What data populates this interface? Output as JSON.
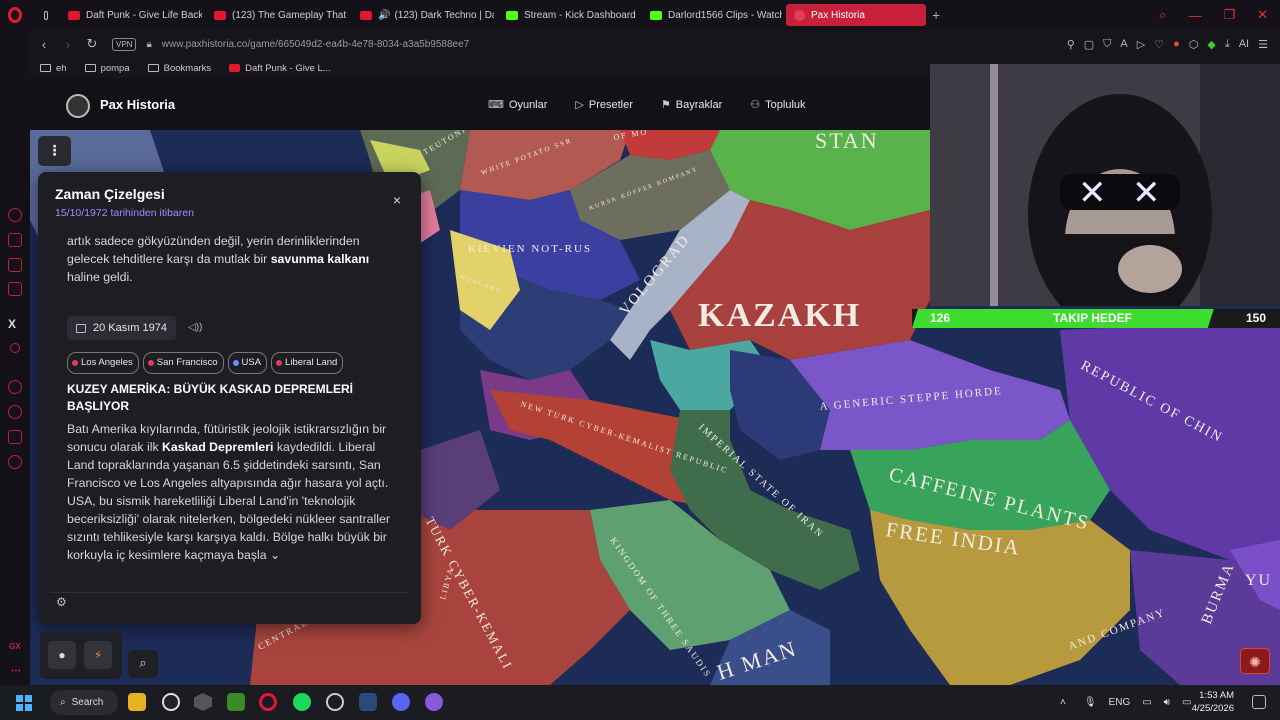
{
  "browser": {
    "tabs": [
      {
        "title": "Daft Punk - Give Life Back",
        "icon": "youtube-icon"
      },
      {
        "title": "(123) The Gameplay That",
        "icon": "youtube-icon"
      },
      {
        "title": "(123) Dark Techno | Da",
        "icon": "youtube-icon"
      },
      {
        "title": "Stream - Kick Dashboard",
        "icon": "kick-icon"
      },
      {
        "title": "Darlord1566 Clips - Watch",
        "icon": "kick-icon"
      },
      {
        "title": "Pax Historia",
        "icon": "pax-icon",
        "active": true
      }
    ],
    "new_tab": "+",
    "vpn_label": "VPN",
    "url": "www.paxhistoria.co/game/665049d2-ea4b-4e78-8034-a3a5b9588ee7",
    "ext_ai": "AI",
    "bookmarks": [
      {
        "label": "eh",
        "type": "folder"
      },
      {
        "label": "pompa",
        "type": "folder"
      },
      {
        "label": "Bookmarks",
        "type": "folder"
      },
      {
        "label": "Daft Punk - Give L...",
        "type": "youtube"
      }
    ]
  },
  "site": {
    "title": "Pax Historia",
    "nav": [
      {
        "label": "Oyunlar",
        "icon": "gamepad-icon"
      },
      {
        "label": "Presetler",
        "icon": "play-icon"
      },
      {
        "label": "Bayraklar",
        "icon": "flag-icon"
      },
      {
        "label": "Topluluk",
        "icon": "users-icon"
      }
    ]
  },
  "timeline": {
    "title": "Zaman Çizelgesi",
    "subtitle": "15/10/1972 tarihinden itibaren",
    "close_icon": "×",
    "prev_text_1": "artık sadece gökyüzünden değil, yerin derinliklerinden gelecek tehditlere karşı da mutlak bir ",
    "prev_text_bold": "savunma kalkanı",
    "prev_text_2": " haline geldi.",
    "date": "20 Kasım 1974",
    "tags": [
      {
        "label": "Los Angeles",
        "color": "#e83a5a"
      },
      {
        "label": "San Francisco",
        "color": "#e83a5a"
      },
      {
        "label": "USA",
        "color": "#6b8bff"
      },
      {
        "label": "Liberal Land",
        "color": "#e83a5a"
      }
    ],
    "event_title": "KUZEY AMERİKA: BÜYÜK KASKAD DEPREMLERİ BAŞLIYOR",
    "event_text_1": "Batı Amerika kıyılarında, fütüristik jeolojik istikrarsızlığın bir sonucu olarak ilk ",
    "event_text_bold": "Kaskad Depremleri",
    "event_text_2": " kaydedildi. Liberal Land topraklarında yaşanan 6.5 şiddetindeki sarsıntı, San Francisco ve Los Angeles altyapısında ağır hasara yol açtı. USA, bu sismik hareketliliği Liberal Land'in 'teknolojik beceriksizliği' olarak nitelerken, bölgedeki nükleer santraller sızıntı tehlikesiyle karşı karşıya kaldı. Bölge halkı büyük bir korkuyla iç kesimlere kaçmaya başla",
    "expand_icon": "⌄"
  },
  "map": {
    "labels": {
      "kazakh": "KAZAKH",
      "stan": "STAN",
      "vologrod": "VOLOGRAD",
      "kievien": "KIEVIEN NOT-RUS",
      "steppe": "A GENERIC STEPPE HORDE",
      "republic": "REPUBLIC OF CHIN",
      "caffeine": "CAFFEINE PLANTS",
      "free_india": "FREE INDIA",
      "imperial": "IMPERIAL STATE OF IRAN",
      "newturk": "NEW TURK CYBER-KEMALIST REPUBLIC",
      "turk_cyber": "TURK CYBER-KEMALI",
      "three_saudis": "KINGDOM OF THREE SAUDIS",
      "burma": "BURMA",
      "oman": "H MAN",
      "white_potato": "WHITE POTATO SSR",
      "kursk": "KURSK KOFFEE KOMPANY",
      "libya": "LIBYA",
      "central": "CENTRAL",
      "company": "AND COMPANY",
      "yu": "YU",
      "teutonic": "TEUTONI",
      "hungary": "HUNGARY",
      "of_mo": "OF MO"
    }
  },
  "stream_goal": {
    "start": "126",
    "label": "TAKIP HEDEF",
    "end": "150",
    "progress": 0.82
  },
  "taskbar": {
    "search": "Search",
    "lang": "ENG",
    "time": "1:53 AM",
    "date": "4/25/2026"
  },
  "sidebar_label": "GX"
}
